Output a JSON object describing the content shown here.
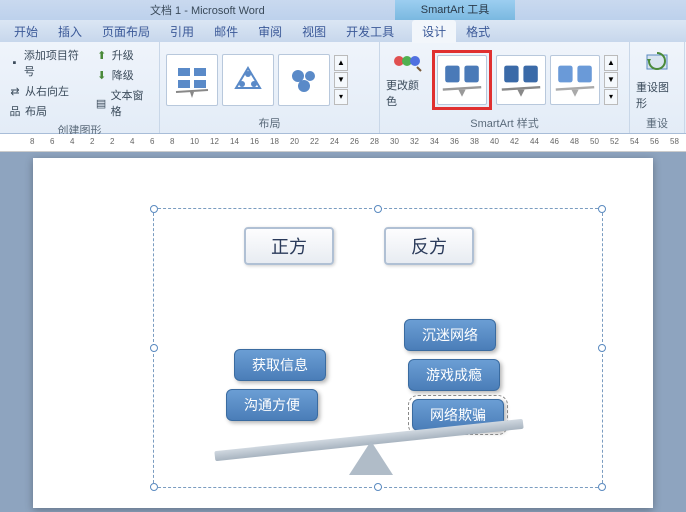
{
  "titlebar": {
    "doc": "文档 1 - Microsoft Word",
    "tool": "SmartArt 工具"
  },
  "tabs": {
    "items": [
      "开始",
      "插入",
      "页面布局",
      "引用",
      "邮件",
      "审阅",
      "视图",
      "开发工具"
    ],
    "tool_items": [
      "设计",
      "格式"
    ],
    "active_tool": "设计"
  },
  "ribbon": {
    "group_create": {
      "label": "创建图形",
      "add_bullet": "添加项目符号",
      "rtl": "从右向左",
      "layout_btn": "布局",
      "promote": "升级",
      "demote": "降级",
      "text_pane": "文本窗格"
    },
    "group_layout": {
      "label": "布局"
    },
    "group_style": {
      "label": "SmartArt 样式",
      "change_colors": "更改颜色"
    },
    "group_reset": {
      "label": "重设",
      "reset_graphic": "重设图形"
    }
  },
  "ruler_marks": [
    8,
    6,
    4,
    2,
    2,
    4,
    6,
    8,
    10,
    12,
    14,
    16,
    18,
    20,
    22,
    24,
    26,
    28,
    30,
    32,
    34,
    36,
    38,
    40,
    42,
    44,
    46,
    48,
    50,
    52,
    54,
    56,
    58
  ],
  "smartart": {
    "title_left": "正方",
    "title_right": "反方",
    "left_nodes": [
      "获取信息",
      "沟通方便"
    ],
    "right_nodes": [
      "沉迷网络",
      "游戏成瘾",
      "网络欺骗"
    ]
  }
}
